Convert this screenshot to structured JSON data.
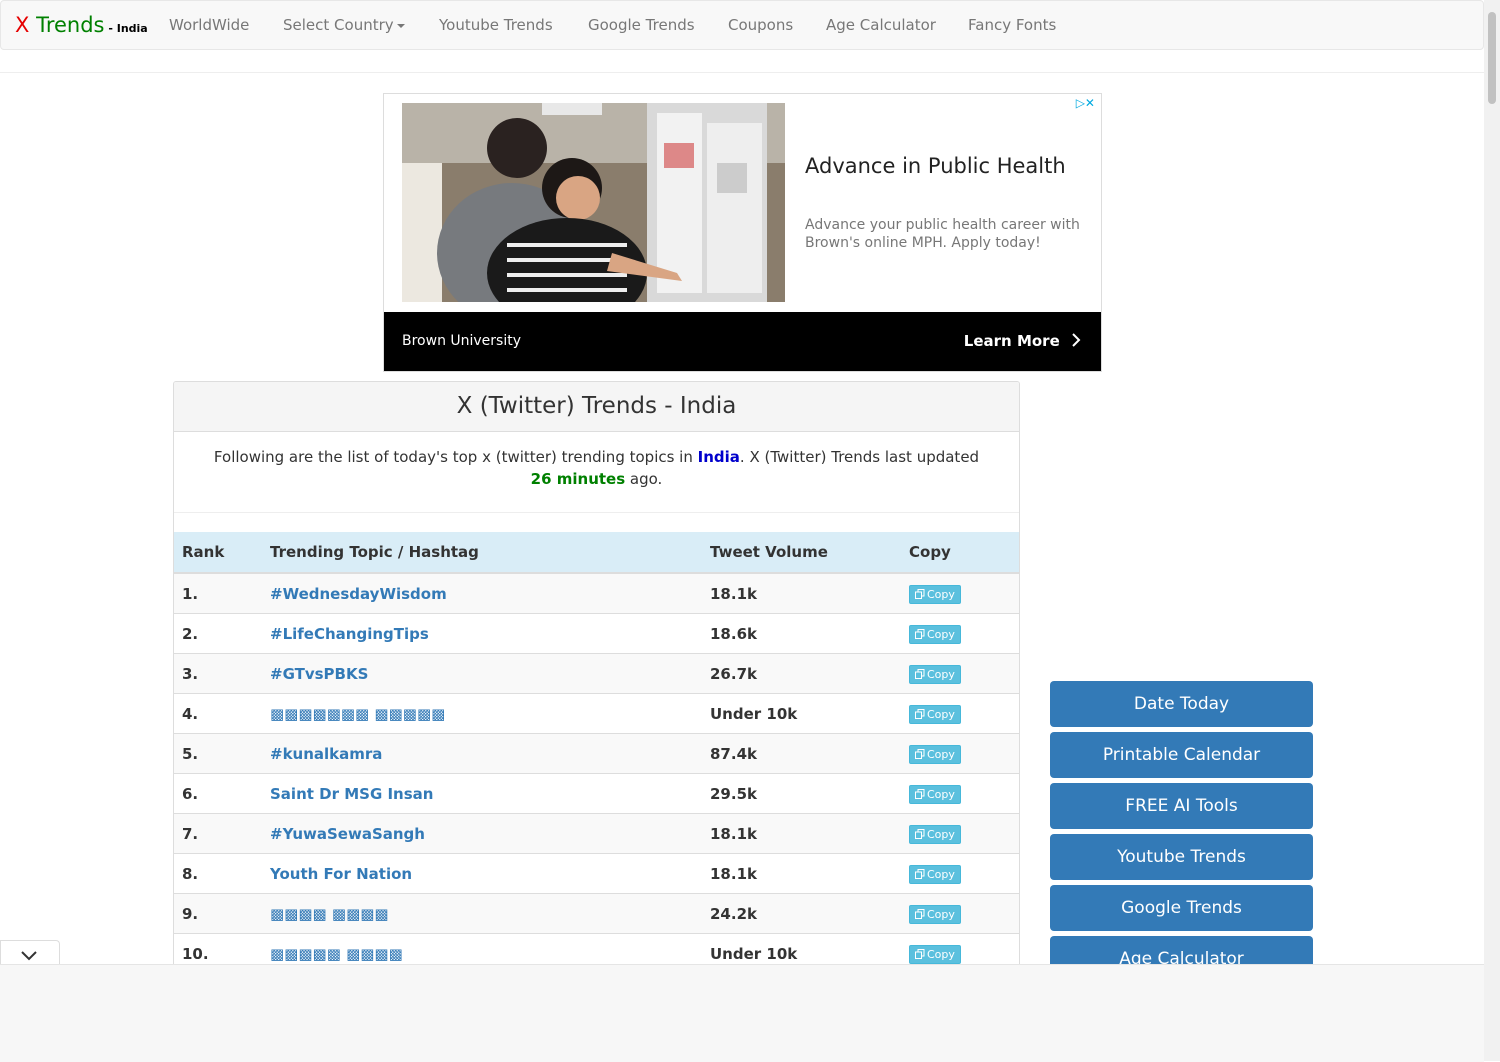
{
  "brand": {
    "x": "X",
    "trends": "Trends",
    "sub": " - India"
  },
  "nav": {
    "worldwide": "WorldWide",
    "select_country": "Select Country",
    "youtube": "Youtube Trends",
    "google": "Google Trends",
    "coupons": "Coupons",
    "age": "Age Calculator",
    "fancy": "Fancy Fonts"
  },
  "ad": {
    "title": "Advance in Public Health",
    "text": "Advance your public health career with Brown's online MPH. Apply today!",
    "brand": "Brown University",
    "cta": "Learn More",
    "choice": "▷✕"
  },
  "panel": {
    "title": "X (Twitter) Trends - India",
    "intro_pre": "Following are the list of today's top x (twitter) trending topics in ",
    "country": "India",
    "intro_mid": ". X (Twitter) Trends last updated ",
    "updated": "26 minutes",
    "intro_post": " ago."
  },
  "table": {
    "headers": {
      "rank": "Rank",
      "topic": "Trending Topic / Hashtag",
      "volume": "Tweet Volume",
      "copy": "Copy"
    },
    "copy_label": "Copy",
    "rows": [
      {
        "rank": "1.",
        "topic": "#WednesdayWisdom",
        "volume": "18.1k"
      },
      {
        "rank": "2.",
        "topic": "#LifeChangingTips",
        "volume": "18.6k"
      },
      {
        "rank": "3.",
        "topic": "#GTvsPBKS",
        "volume": "26.7k"
      },
      {
        "rank": "4.",
        "topic": "▩▩▩▩▩▩▩ ▩▩▩▩▩",
        "volume": "Under 10k"
      },
      {
        "rank": "5.",
        "topic": "#kunalkamra",
        "volume": "87.4k"
      },
      {
        "rank": "6.",
        "topic": "Saint Dr MSG Insan",
        "volume": "29.5k"
      },
      {
        "rank": "7.",
        "topic": "#YuwaSewaSangh",
        "volume": "18.1k"
      },
      {
        "rank": "8.",
        "topic": "Youth For Nation",
        "volume": "18.1k"
      },
      {
        "rank": "9.",
        "topic": "▩▩▩▩ ▩▩▩▩",
        "volume": "24.2k"
      },
      {
        "rank": "10.",
        "topic": "▩▩▩▩▩ ▩▩▩▩",
        "volume": "Under 10k"
      }
    ]
  },
  "side": {
    "b1": "Date Today",
    "b2": "Printable Calendar",
    "b3": "FREE AI Tools",
    "b4": "Youtube Trends",
    "b5": "Google Trends",
    "b6": "Age Calculator"
  },
  "colors": {
    "link": "#337ab7",
    "brand_red": "#e60000",
    "brand_green": "#008000",
    "side_button": "#337ab7"
  },
  "icons": {
    "copy": "copy-icon",
    "collapse": "chevron-down-icon",
    "cta": "chevron-right-icon"
  }
}
